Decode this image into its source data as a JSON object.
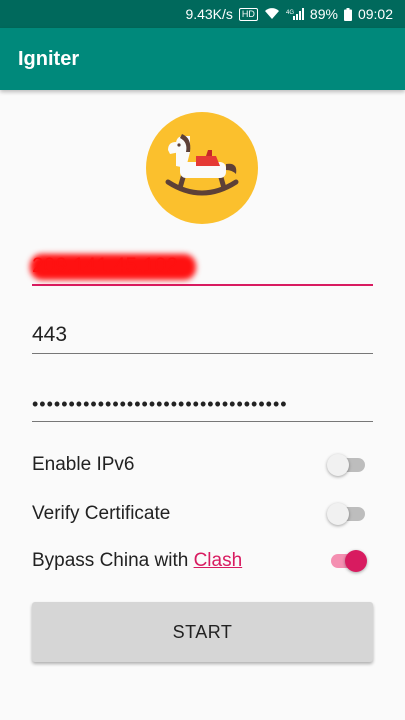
{
  "status_bar": {
    "speed": "9.43K/s",
    "hd_badge": "HD",
    "network": "4G",
    "battery": "89%",
    "time": "09:02"
  },
  "app_bar": {
    "title": "Igniter"
  },
  "logo": {
    "icon": "rocking-horse-icon",
    "background": "#fbc02d"
  },
  "form": {
    "server": {
      "value": "209.141.45.102",
      "redacted": true
    },
    "port": {
      "value": "443"
    },
    "password": {
      "value": "•••••••••••••••••••••••••••••••••••"
    }
  },
  "options": {
    "ipv6": {
      "label": "Enable IPv6",
      "on": false
    },
    "verify_cert": {
      "label": "Verify Certificate",
      "on": false
    },
    "bypass": {
      "label_prefix": "Bypass China with ",
      "link": "Clash",
      "on": true
    }
  },
  "start_button": {
    "label": "START"
  },
  "colors": {
    "app_bar": "#00897b",
    "status_bar": "#00695c",
    "accent": "#d81b60",
    "button": "#d6d6d6"
  }
}
